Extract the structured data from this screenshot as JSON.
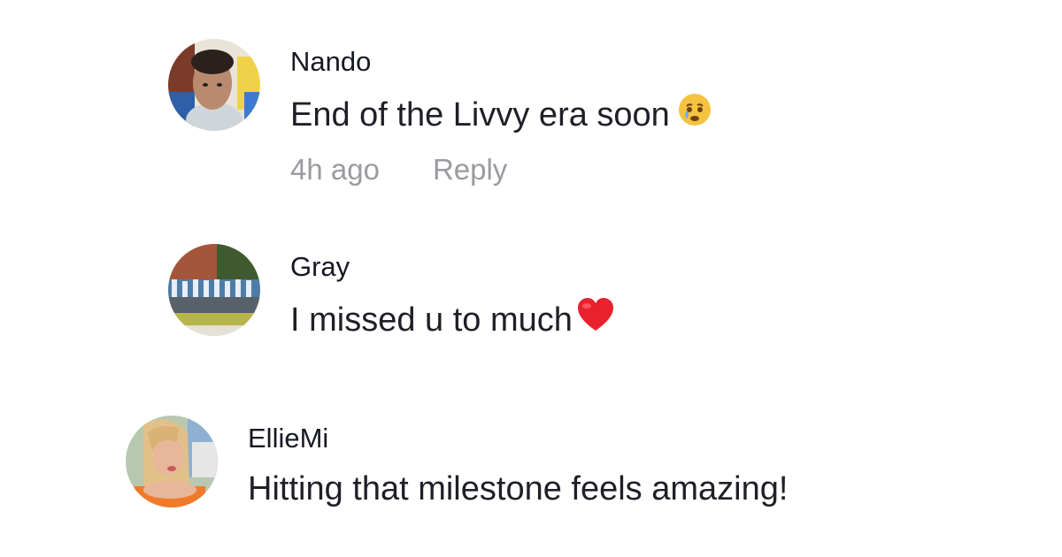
{
  "comments": [
    {
      "username": "Nando",
      "text": "End of the Livvy era soon",
      "emoji": "crying-face-icon",
      "time": "4h ago",
      "reply_label": "Reply"
    },
    {
      "username": "Gray",
      "text": "I missed u to much",
      "emoji": "red-heart-icon"
    },
    {
      "username": "EllieMi",
      "text": "Hitting that milestone feels amazing!"
    }
  ],
  "colors": {
    "username": "#161823",
    "text": "#1f1f27",
    "meta": "#9a9ba0",
    "heart": "#e8212c",
    "emoji_face": "#f6c340"
  }
}
